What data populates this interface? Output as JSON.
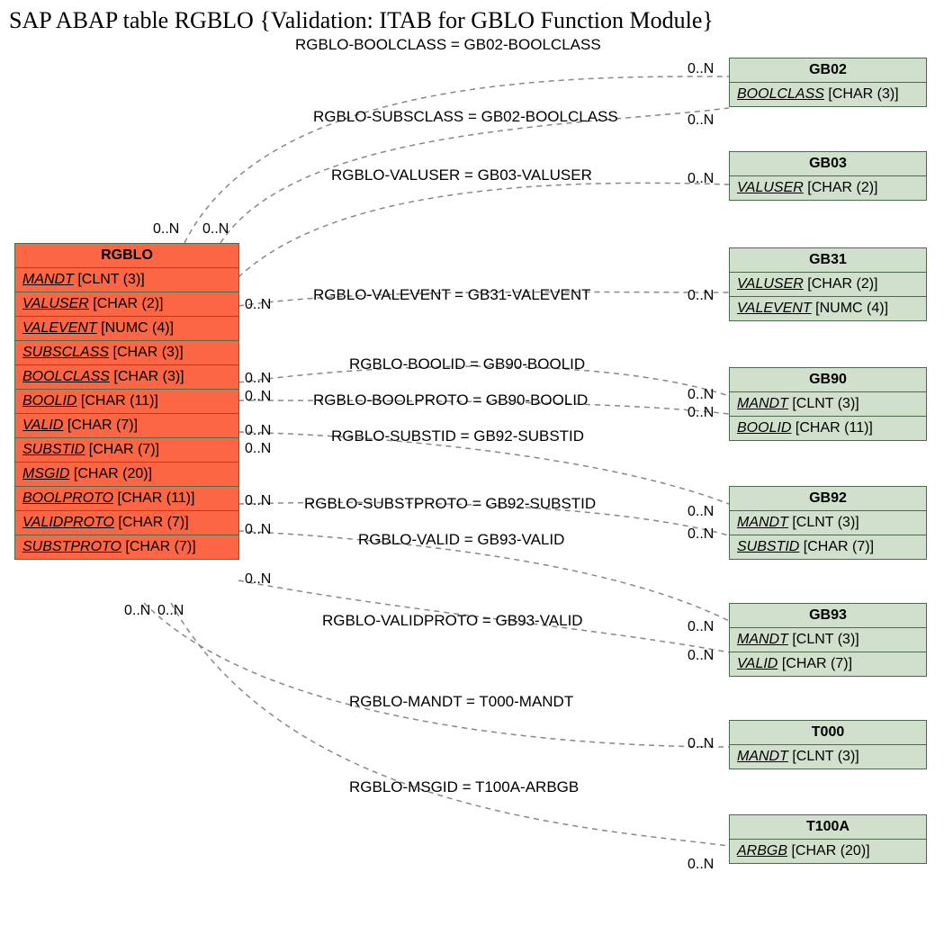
{
  "title": "SAP ABAP table RGBLO {Validation: ITAB for GBLO Function Module}",
  "main": {
    "name": "RGBLO",
    "fields": [
      {
        "name": "MANDT",
        "type": "[CLNT (3)]"
      },
      {
        "name": "VALUSER",
        "type": "[CHAR (2)]"
      },
      {
        "name": "VALEVENT",
        "type": "[NUMC (4)]"
      },
      {
        "name": "SUBSCLASS",
        "type": "[CHAR (3)]"
      },
      {
        "name": "BOOLCLASS",
        "type": "[CHAR (3)]"
      },
      {
        "name": "BOOLID",
        "type": "[CHAR (11)]"
      },
      {
        "name": "VALID",
        "type": "[CHAR (7)]"
      },
      {
        "name": "SUBSTID",
        "type": "[CHAR (7)]"
      },
      {
        "name": "MSGID",
        "type": "[CHAR (20)]"
      },
      {
        "name": "BOOLPROTO",
        "type": "[CHAR (11)]"
      },
      {
        "name": "VALIDPROTO",
        "type": "[CHAR (7)]"
      },
      {
        "name": "SUBSTPROTO",
        "type": "[CHAR (7)]"
      }
    ]
  },
  "refs": [
    {
      "name": "GB02",
      "fields": [
        {
          "name": "BOOLCLASS",
          "type": "[CHAR (3)]"
        }
      ]
    },
    {
      "name": "GB03",
      "fields": [
        {
          "name": "VALUSER",
          "type": "[CHAR (2)]"
        }
      ]
    },
    {
      "name": "GB31",
      "fields": [
        {
          "name": "VALUSER",
          "type": "[CHAR (2)]"
        },
        {
          "name": "VALEVENT",
          "type": "[NUMC (4)]"
        }
      ]
    },
    {
      "name": "GB90",
      "fields": [
        {
          "name": "MANDT",
          "type": "[CLNT (3)]"
        },
        {
          "name": "BOOLID",
          "type": "[CHAR (11)]"
        }
      ]
    },
    {
      "name": "GB92",
      "fields": [
        {
          "name": "MANDT",
          "type": "[CLNT (3)]"
        },
        {
          "name": "SUBSTID",
          "type": "[CHAR (7)]"
        }
      ]
    },
    {
      "name": "GB93",
      "fields": [
        {
          "name": "MANDT",
          "type": "[CLNT (3)]"
        },
        {
          "name": "VALID",
          "type": "[CHAR (7)]"
        }
      ]
    },
    {
      "name": "T000",
      "fields": [
        {
          "name": "MANDT",
          "type": "[CLNT (3)]"
        }
      ]
    },
    {
      "name": "T100A",
      "fields": [
        {
          "name": "ARBGB",
          "type": "[CHAR (20)]"
        }
      ]
    }
  ],
  "rels": [
    {
      "text": "RGBLO-BOOLCLASS = GB02-BOOLCLASS",
      "lcard": "0..N",
      "rcard": "0..N"
    },
    {
      "text": "RGBLO-SUBSCLASS = GB02-BOOLCLASS",
      "lcard": "0..N",
      "rcard": "0..N"
    },
    {
      "text": "RGBLO-VALUSER = GB03-VALUSER",
      "lcard": "0..N",
      "rcard": "0..N"
    },
    {
      "text": "RGBLO-VALEVENT = GB31-VALEVENT",
      "lcard": "0..N",
      "rcard": "0..N"
    },
    {
      "text": "RGBLO-BOOLID = GB90-BOOLID",
      "lcard": "0..N",
      "rcard": "0..N"
    },
    {
      "text": "RGBLO-BOOLPROTO = GB90-BOOLID",
      "lcard": "0..N",
      "rcard": "0..N"
    },
    {
      "text": "RGBLO-SUBSTID = GB92-SUBSTID",
      "lcard": "0..N",
      "rcard": "0..N"
    },
    {
      "text": "RGBLO-SUBSTPROTO = GB92-SUBSTID",
      "lcard": "0..N",
      "rcard": "0..N"
    },
    {
      "text": "RGBLO-VALID = GB93-VALID",
      "lcard": "0..N",
      "rcard": "0..N"
    },
    {
      "text": "RGBLO-VALIDPROTO = GB93-VALID",
      "lcard": "0..N",
      "rcard": "0..N"
    },
    {
      "text": "RGBLO-MANDT = T000-MANDT",
      "lcard": "0..N",
      "rcard": "0..N"
    },
    {
      "text": "RGBLO-MSGID = T100A-ARBGB",
      "lcard": "0..N",
      "rcard": "0..N"
    }
  ]
}
